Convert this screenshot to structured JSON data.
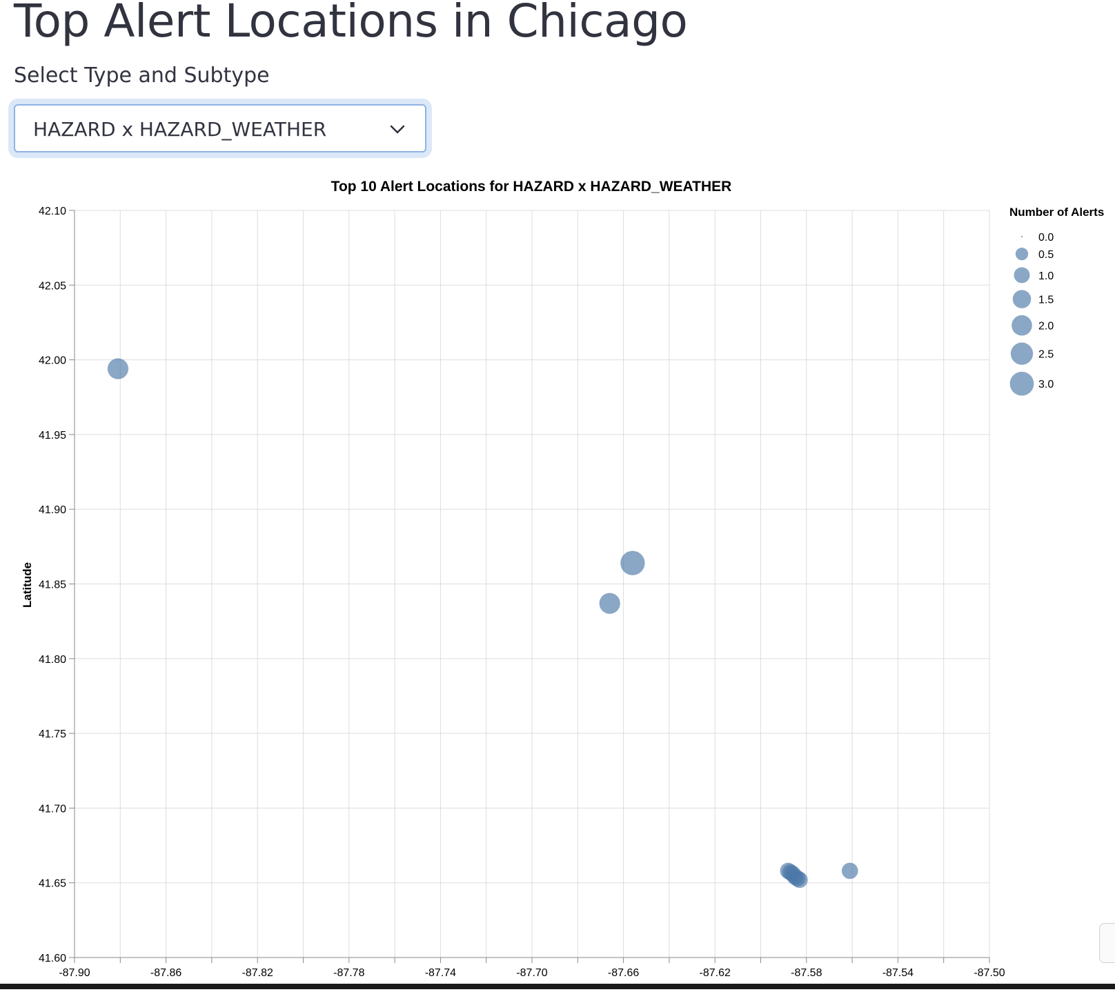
{
  "page": {
    "title": "Top Alert Locations in Chicago",
    "select_label": "Select Type and Subtype",
    "selected_option": "HAZARD x HAZARD_WEATHER"
  },
  "chart_data": {
    "type": "scatter",
    "title": "Top 10 Alert Locations for HAZARD x HAZARD_WEATHER",
    "xlabel": "",
    "ylabel": "Latitude",
    "xlim": [
      -87.9,
      -87.5
    ],
    "ylim": [
      41.6,
      42.1
    ],
    "x_ticks": [
      "-87.90",
      "-87.86",
      "-87.82",
      "-87.78",
      "-87.74",
      "-87.70",
      "-87.66",
      "-87.62",
      "-87.58",
      "-87.54",
      "-87.50"
    ],
    "y_ticks": [
      "42.10",
      "42.05",
      "42.00",
      "41.95",
      "41.90",
      "41.85",
      "41.80",
      "41.75",
      "41.70",
      "41.65",
      "41.60"
    ],
    "x_tick_step": 0.02,
    "grid": true,
    "size_field": "Number of Alerts",
    "legend": {
      "title": "Number of Alerts",
      "placement": "top-right",
      "entries": [
        "0.0",
        "0.5",
        "1.0",
        "1.5",
        "2.0",
        "2.5",
        "3.0"
      ],
      "values": [
        0,
        0.5,
        1.0,
        1.5,
        2.0,
        2.5,
        3.0
      ]
    },
    "points": [
      {
        "lon": -87.881,
        "lat": 41.994,
        "alerts": 2
      },
      {
        "lon": -87.656,
        "lat": 41.864,
        "alerts": 3
      },
      {
        "lon": -87.666,
        "lat": 41.837,
        "alerts": 2
      },
      {
        "lon": -87.588,
        "lat": 41.658,
        "alerts": 1
      },
      {
        "lon": -87.587,
        "lat": 41.657,
        "alerts": 1
      },
      {
        "lon": -87.586,
        "lat": 41.656,
        "alerts": 1
      },
      {
        "lon": -87.585,
        "lat": 41.654,
        "alerts": 1
      },
      {
        "lon": -87.584,
        "lat": 41.653,
        "alerts": 1
      },
      {
        "lon": -87.583,
        "lat": 41.652,
        "alerts": 1
      },
      {
        "lon": -87.561,
        "lat": 41.658,
        "alerts": 1
      }
    ],
    "colors": {
      "point": "#4c78a8",
      "grid": "#dddddd",
      "axis": "#888888",
      "text": "#000000"
    }
  }
}
